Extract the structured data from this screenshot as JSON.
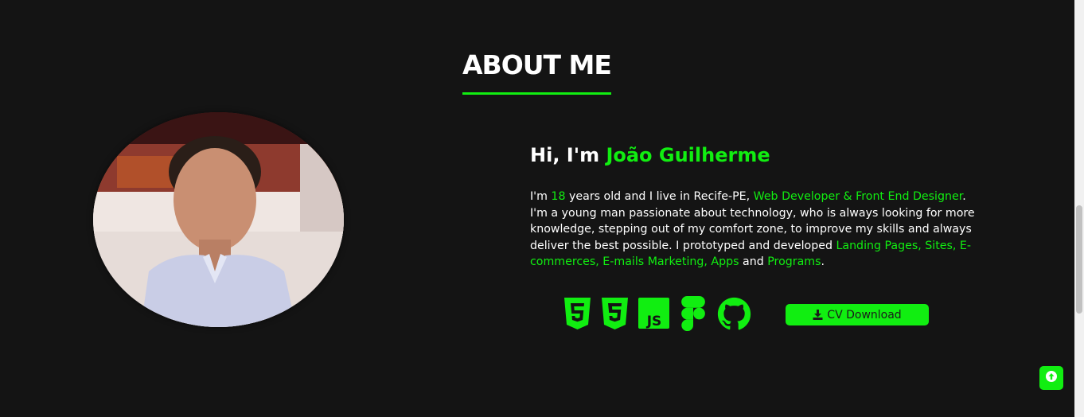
{
  "colors": {
    "background": "#141414",
    "accent": "#11ee11",
    "text": "#ffffff"
  },
  "section": {
    "title": "ABOUT ME"
  },
  "intro": {
    "greeting_prefix": "Hi, I'm ",
    "name": "João Guilherme"
  },
  "bio": {
    "p1": "I'm ",
    "age": "18",
    "p2": " years old and I live in Recife-PE, ",
    "role": "Web Developer & Front End Designer",
    "p3": ". I'm a young man passionate about technology, who is always looking for more knowledge, stepping out of my comfort zone, to improve my skills and always deliver the best possible. I prototyped and developed ",
    "projects": "Landing Pages, Sites, E-commerces, E-mails Marketing, Apps",
    "p4": " and ",
    "programs": "Programs",
    "p5": "."
  },
  "skills": [
    {
      "icon": "html5-icon"
    },
    {
      "icon": "css3-icon"
    },
    {
      "icon": "javascript-icon"
    },
    {
      "icon": "figma-icon"
    },
    {
      "icon": "github-icon"
    }
  ],
  "actions": {
    "cv_download_label": "CV Download",
    "cv_download_icon": "download-icon",
    "back_to_top_icon": "arrow-up-icon"
  }
}
